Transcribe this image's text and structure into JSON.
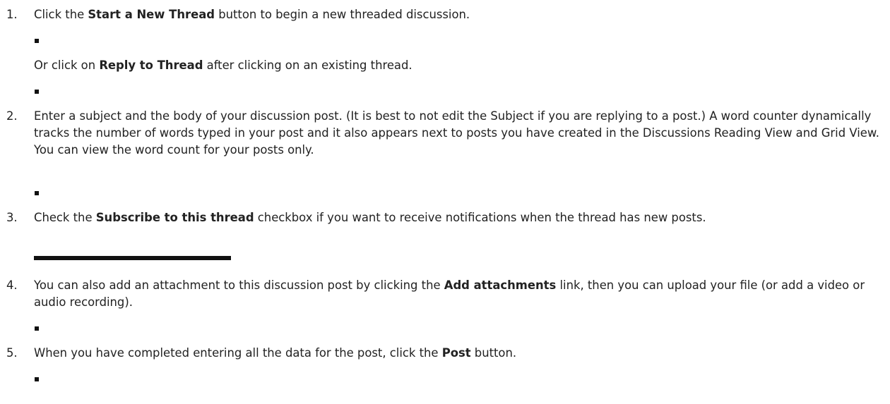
{
  "steps": [
    {
      "number": "1.",
      "pre": "Click the ",
      "bold": "Start a New Thread",
      "post": " button to begin a new threaded discussion.",
      "alt": {
        "pre": "Or click on ",
        "bold": "Reply to Thread",
        "post": " after clicking on an existing thread."
      }
    },
    {
      "number": "2.",
      "text": "Enter a subject and the body of your discussion post. (It is best to not edit the Subject if you are replying to a post.) A word counter dynamically tracks the number of words typed in your post and it also appears next to posts you have created in the Discussions Reading View and Grid View. You can view the word count for your posts only."
    },
    {
      "number": "3.",
      "pre": "Check the ",
      "bold": "Subscribe to this thread",
      "post": " checkbox if you want to receive notifications when the thread has new posts."
    },
    {
      "number": "4.",
      "pre": "You can also add an attachment to this discussion post by clicking the ",
      "bold": "Add attachments",
      "post": " link, then you can upload your file (or add a video or audio recording)."
    },
    {
      "number": "5.",
      "pre": "When you have completed entering all the data for the post, click the ",
      "bold": "Post",
      "post": " button."
    }
  ]
}
